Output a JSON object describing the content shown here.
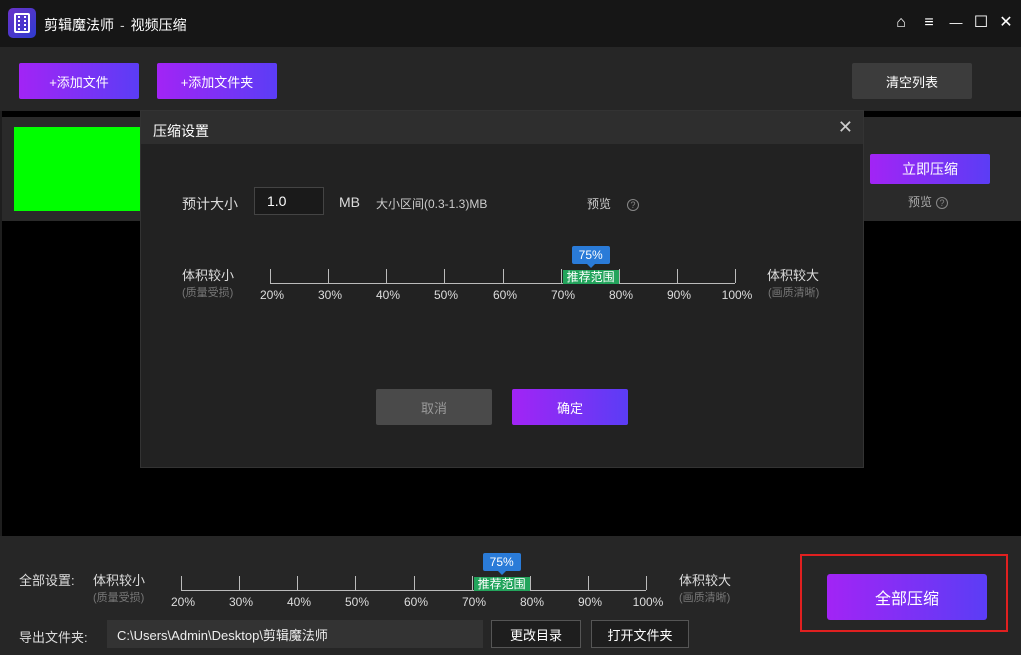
{
  "titlebar": {
    "app_name": "剪辑魔法师",
    "separator": "-",
    "module": "视频压缩",
    "controls": {
      "home": "⌂",
      "menu": "≡",
      "minimize": "—",
      "maximize": "☐",
      "close": "✕"
    }
  },
  "toolbar": {
    "add_file": "+添加文件",
    "add_folder": "+添加文件夹",
    "clear_list": "清空列表"
  },
  "file_row": {
    "compress_now": "立即压缩",
    "preview": "预览",
    "help": "?"
  },
  "dialog": {
    "title": "压缩设置",
    "close": "✕",
    "estimated_size_label": "预计大小",
    "estimated_size_value": "1.0",
    "unit": "MB",
    "range_text": "大小区间(0.3-1.3)MB",
    "preview": "预览",
    "help": "?",
    "left_label": "体积较小",
    "left_sub": "(质量受损)",
    "right_label": "体积较大",
    "right_sub": "(画质清晰)",
    "slider": {
      "ticks": [
        "20%",
        "30%",
        "40%",
        "50%",
        "60%",
        "70%",
        "80%",
        "90%",
        "100%"
      ],
      "value_label": "75%",
      "value": 75,
      "recommended_label": "推荐范围",
      "recommended_range": [
        70,
        80
      ]
    },
    "cancel": "取消",
    "confirm": "确定"
  },
  "bottom": {
    "global_settings_label": "全部设置:",
    "left_label": "体积较小",
    "left_sub": "(质量受损)",
    "right_label": "体积较大",
    "right_sub": "(画质清晰)",
    "slider": {
      "ticks": [
        "20%",
        "30%",
        "40%",
        "50%",
        "60%",
        "70%",
        "80%",
        "90%",
        "100%"
      ],
      "value_label": "75%",
      "value": 75,
      "recommended_label": "推荐范围",
      "recommended_range": [
        70,
        80
      ]
    },
    "export_folder_label": "导出文件夹:",
    "export_path": "C:\\Users\\Admin\\Desktop\\剪辑魔法师",
    "change_dir": "更改目录",
    "open_folder": "打开文件夹",
    "compress_all": "全部压缩"
  },
  "colors": {
    "accent_gradient_start": "#a224f5",
    "accent_gradient_end": "#5b3df5",
    "recommended_green": "#23a45c",
    "bubble_blue": "#2a7bd8",
    "highlight_red": "#e02020",
    "thumbnail_green": "#00ff00"
  }
}
